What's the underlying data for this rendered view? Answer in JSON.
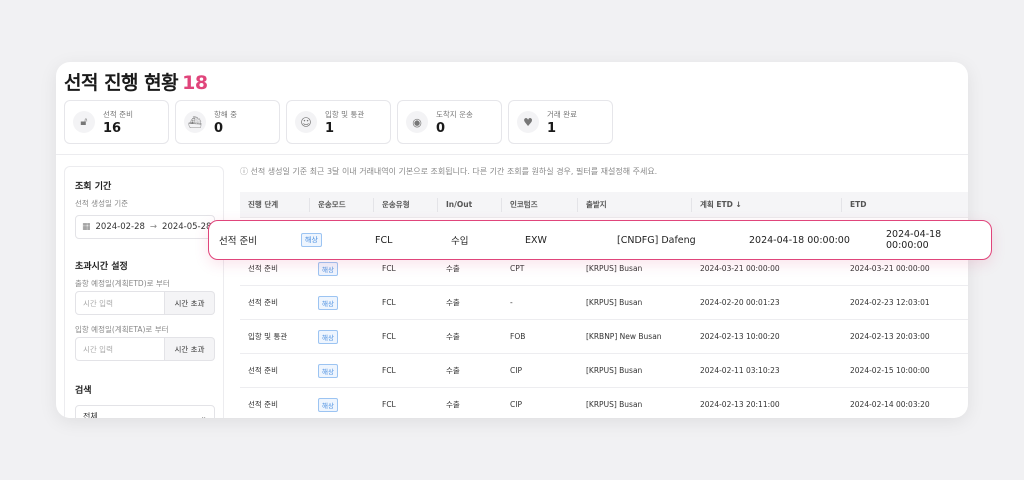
{
  "header": {
    "title": "선적 진행 현황",
    "count": "18"
  },
  "stats": [
    {
      "label": "선적 준비",
      "value": "16",
      "icon": "unlock-icon"
    },
    {
      "label": "항해 중",
      "value": "0",
      "icon": "ship-icon"
    },
    {
      "label": "입항 및 통관",
      "value": "1",
      "icon": "customs-icon"
    },
    {
      "label": "도착지 운송",
      "value": "0",
      "icon": "location-icon"
    },
    {
      "label": "거래 완료",
      "value": "1",
      "icon": "handshake-icon"
    }
  ],
  "filters": {
    "period_title": "조회 기간",
    "period_basis": "선적 생성일 기준",
    "date_from": "2024-02-28",
    "date_to": "2024-05-28",
    "overtime_title": "초과시간 설정",
    "etd_label": "출항 예정일(계획ETD)로 부터",
    "etd_placeholder": "시간 입력",
    "etd_button": "시간 초과",
    "eta_label": "입항 예정일(계획ETA)로 부터",
    "eta_placeholder": "시간 입력",
    "eta_button": "시간 초과",
    "search_title": "검색",
    "search_select": "전체"
  },
  "info_text": "선적 생성일 기준 최근 3달 이내 거래내역이 기본으로 조회됩니다. 다른 기간 조회를 원하실 경우, 필터를 재설정해 주세요.",
  "table": {
    "headers": [
      "진행 단계",
      "운송모드",
      "운송유형",
      "In/Out",
      "인코텀즈",
      "출발지",
      "계획 ETD ↓",
      "ETD"
    ],
    "rows": [
      [
        "선적 준비",
        "해상",
        "FCL",
        "수출",
        "CPT",
        "[KRPUS] Busan",
        "2024-03-21 00:00:00",
        "2024-03-21 00:00:00"
      ],
      [
        "선적 준비",
        "해상",
        "FCL",
        "수출",
        "-",
        "[KRPUS] Busan",
        "2024-02-20 00:01:23",
        "2024-02-23 12:03:01"
      ],
      [
        "입항 및 통관",
        "해상",
        "FCL",
        "수출",
        "FOB",
        "[KRBNP] New Busan",
        "2024-02-13 10:00:20",
        "2024-02-13 20:03:00"
      ],
      [
        "선적 준비",
        "해상",
        "FCL",
        "수출",
        "CIP",
        "[KRPUS] Busan",
        "2024-02-11 03:10:23",
        "2024-02-15 10:00:00"
      ],
      [
        "선적 준비",
        "해상",
        "FCL",
        "수출",
        "CIP",
        "[KRPUS] Busan",
        "2024-02-13 20:11:00",
        "2024-02-14 00:03:20"
      ]
    ]
  },
  "highlight_row": [
    "선적 준비",
    "해상",
    "FCL",
    "수입",
    "EXW",
    "[CNDFG] Dafeng",
    "2024-04-18 00:00:00",
    "2024-04-18 00:00:00"
  ],
  "colors": {
    "accent": "#e0457b",
    "badge": "#4a8fe0"
  }
}
